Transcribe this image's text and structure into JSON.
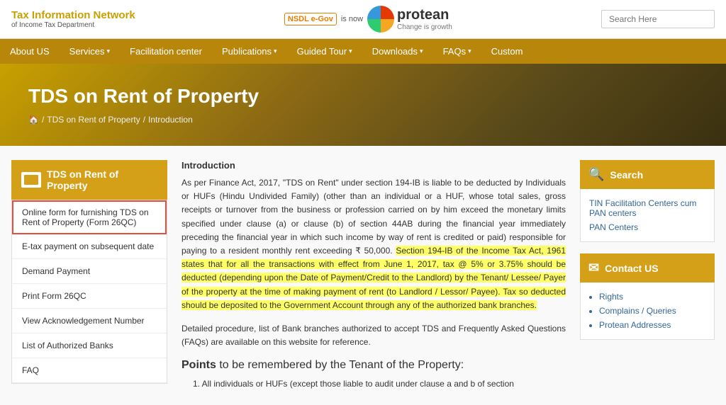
{
  "header": {
    "tin_title": "Tax Information Network",
    "tin_sub": "of Income Tax Department",
    "nsdl_label": "NSDL e-Gov",
    "is_now": "is now",
    "protean_name": "protean",
    "change_growth": "Change is growth",
    "search_placeholder": "Search Here"
  },
  "nav": {
    "items": [
      {
        "label": "About US",
        "has_arrow": false
      },
      {
        "label": "Services",
        "has_arrow": true
      },
      {
        "label": "Facilitation center",
        "has_arrow": false
      },
      {
        "label": "Publications",
        "has_arrow": true
      },
      {
        "label": "Guided Tour",
        "has_arrow": true
      },
      {
        "label": "Downloads",
        "has_arrow": true
      },
      {
        "label": "FAQs",
        "has_arrow": true
      },
      {
        "label": "Custom",
        "has_arrow": false
      }
    ]
  },
  "hero": {
    "title": "TDS on Rent of Property",
    "breadcrumb": [
      {
        "label": "🏠",
        "link": true
      },
      {
        "label": "TDS on Rent of Property",
        "link": true
      },
      {
        "label": "Introduction",
        "link": false
      }
    ]
  },
  "sidebar": {
    "header": "TDS on Rent of Property",
    "items": [
      {
        "label": "Online form for furnishing TDS on Rent of Property (Form 26QC)",
        "active": true
      },
      {
        "label": "E-tax payment on subsequent date",
        "active": false
      },
      {
        "label": "Demand Payment",
        "active": false
      },
      {
        "label": "Print Form 26QC",
        "active": false
      },
      {
        "label": "View Acknowledgement Number",
        "active": false
      },
      {
        "label": "List of Authorized Banks",
        "active": false
      },
      {
        "label": "FAQ",
        "active": false
      }
    ]
  },
  "content": {
    "intro_label": "Introduction",
    "paragraph1": "As per Finance Act, 2017, \"TDS on Rent\" under section 194-IB is liable to be deducted by Individuals or HUFs (Hindu Undivided Family) (other than an individual or a HUF, whose total sales, gross receipts or turnover from the business or profession carried on by him exceed the monetary limits specified under clause (a) or clause (b) of section 44AB during the financial year immediately preceding the financial year in which such income by way of rent is credited or paid) responsible for paying to a resident monthly rent exceeding ₹ 50,000. Section 194-IB of the Income Tax Act, 1961 states that for all the transactions with effect from June 1, 2017, tax @ 5% or 3.75% should be deducted (depending upon the Date of Payment/Credit to the Landlord) by the Tenant/ Lessee/ Payer of the property at the time of making payment of rent (to Landlord / Lessor/ Payee). Tax so deducted should be deposited to the Government Account through any of the authorized bank branches.",
    "paragraph2": "Detailed procedure, list of Bank branches authorized to accept TDS and Frequently Asked Questions (FAQs) are available on this website for reference.",
    "points_heading": "Points to be remembered by the Tenant of the Property:",
    "points_list": "1. All individuals or HUFs (except those liable to audit under clause a and b of section"
  },
  "right_search": {
    "header": "Search",
    "links": [
      "TIN Facilitation Centers cum PAN centers",
      "PAN Centers"
    ]
  },
  "right_contact": {
    "header": "Contact US",
    "links": [
      "Rights",
      "Complains / Queries",
      "Protean Addresses"
    ]
  }
}
